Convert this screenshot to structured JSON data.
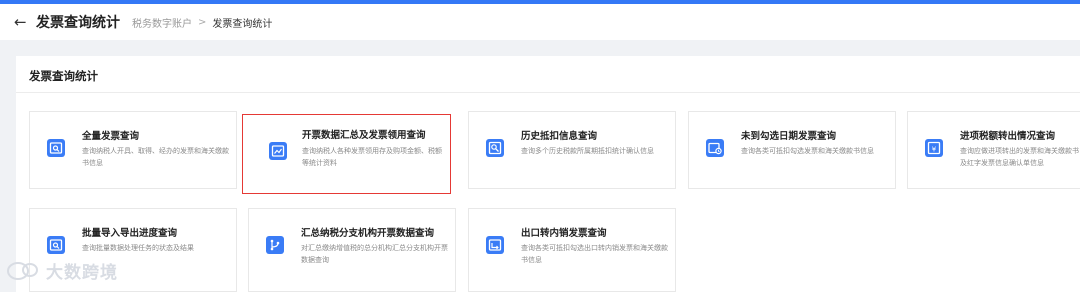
{
  "header": {
    "title": "发票查询统计",
    "breadcrumb": {
      "root": "税务数字账户",
      "separator": ">",
      "current": "发票查询统计"
    }
  },
  "panel": {
    "title": "发票查询统计"
  },
  "cards": [
    {
      "title": "全量发票查询",
      "desc": "查询纳税人开具、取得、经办的发票和海关缴款书信息",
      "icon": "invoice-search-icon"
    },
    {
      "title": "开票数据汇总及发票领用查询",
      "desc": "查询纳税人各种发票领用存及购项金额、税额等统计资料",
      "icon": "trend-chart-icon"
    },
    {
      "title": "历史抵扣信息查询",
      "desc": "查询多个历史税款所属期抵扣统计确认信息",
      "icon": "history-search-icon"
    },
    {
      "title": "未到勾选日期发票查询",
      "desc": "查询各类可抵扣勾选发票和海关缴款书信息",
      "icon": "calendar-clock-icon"
    },
    {
      "title": "进项税额转出情况查询",
      "desc": "查询应做进项转出的发票和海关缴款书及红字发票信息确认单信息",
      "icon": "tax-transfer-icon"
    },
    {
      "title": "批量导入导出进度查询",
      "desc": "查询批量数据处理任务的状态及结果",
      "icon": "batch-progress-icon"
    },
    {
      "title": "汇总纳税分支机构开票数据查询",
      "desc": "对汇总缴纳增值税的总分机构汇总分支机构开票数据查询",
      "icon": "branch-org-icon"
    },
    {
      "title": "出口转内销发票查询",
      "desc": "查询各类可抵扣勾选出口转内销发票和海关缴款书信息",
      "icon": "export-invoice-icon"
    }
  ],
  "highlighted_card_index": 1,
  "colors": {
    "accent": "#3a7cf6",
    "highlight_border": "#e53935",
    "top_bar": "#3478f6"
  },
  "watermark": {
    "text": "大数跨境"
  }
}
